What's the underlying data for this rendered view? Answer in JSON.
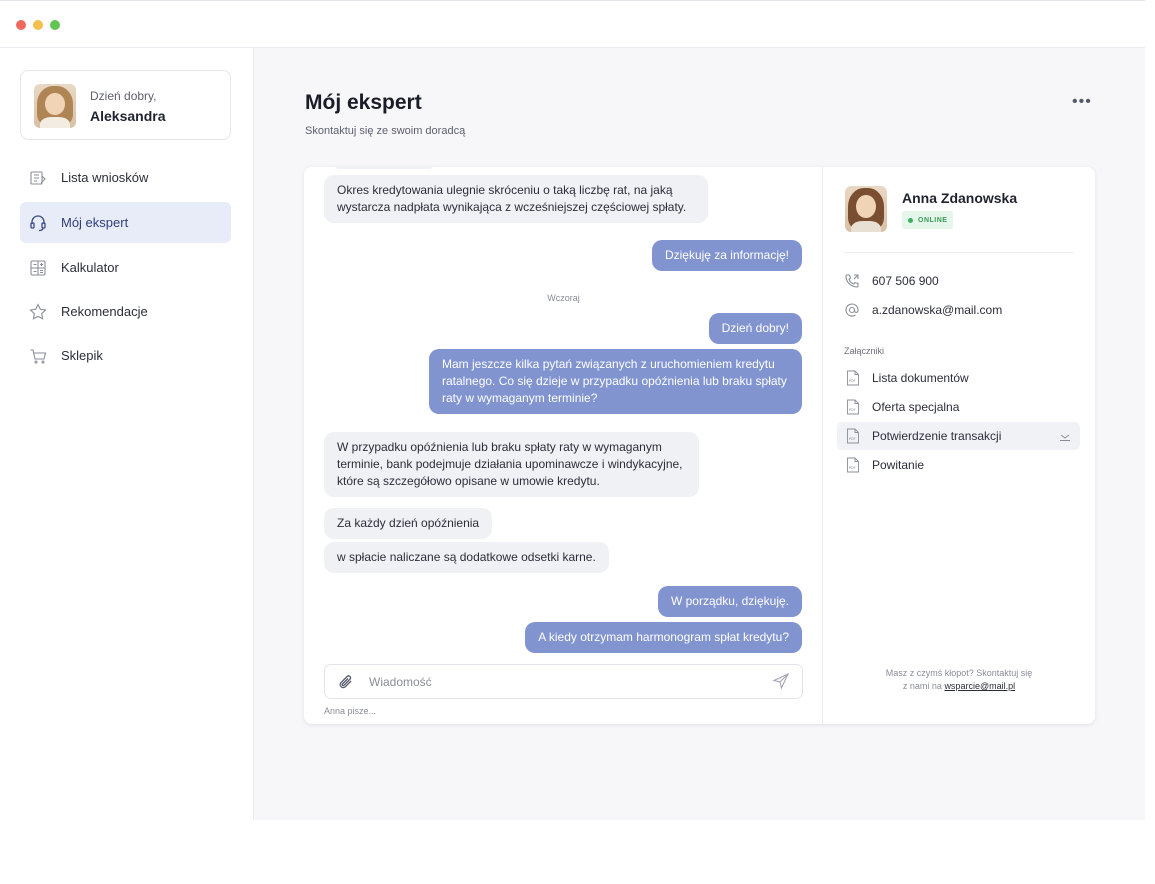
{
  "sidebar": {
    "greeting": "Dzień dobry,",
    "user_name": "Aleksandra",
    "items": [
      {
        "label": "Lista wniosków",
        "icon": "documents-icon"
      },
      {
        "label": "Mój ekspert",
        "icon": "headset-icon",
        "active": true
      },
      {
        "label": "Kalkulator",
        "icon": "calculator-icon"
      },
      {
        "label": "Rekomendacje",
        "icon": "star-icon"
      },
      {
        "label": "Sklepik",
        "icon": "cart-icon"
      }
    ]
  },
  "header": {
    "title": "Mój ekspert",
    "subtitle": "Skontaktuj się ze swoim doradcą",
    "more_label": "•••"
  },
  "chat": {
    "messages": [
      {
        "from": "expert",
        "text": "Okres kredytowania ulegnie skróceniu o taką liczbę rat, na jaką wystarcza nadpłata wynikająca z wcześniejszej częściowej spłaty."
      },
      {
        "from": "user",
        "text": "Dziękuję za informację!"
      },
      {
        "from": "user",
        "text": "Dzień dobry!"
      },
      {
        "from": "user",
        "text": "Mam jeszcze kilka pytań związanych z uruchomieniem kredytu ratalnego. Co się dzieje w przypadku opóźnienia lub braku spłaty raty w wymaganym terminie?"
      },
      {
        "from": "expert",
        "text": "W przypadku opóźnienia lub braku spłaty raty w wymaganym terminie, bank podejmuje działania upominawcze i windykacyjne, które są szczegółowo opisane w umowie kredytu."
      },
      {
        "from": "expert",
        "text": "Za każdy dzień opóźnienia"
      },
      {
        "from": "expert",
        "text": "w spłacie naliczane są dodatkowe odsetki karne."
      },
      {
        "from": "user",
        "text": "W porządku, dziękuję."
      },
      {
        "from": "user",
        "text": "A kiedy otrzymam harmonogram spłat kredytu?"
      }
    ],
    "day_separator": "Wczoraj",
    "input_placeholder": "Wiadomość",
    "input_value": "",
    "typing_status": "Anna pisze..."
  },
  "expert": {
    "name": "Anna Zdanowska",
    "status": "ONLINE",
    "phone": "607 506 900",
    "email": "a.zdanowska@mail.com",
    "attachments_title": "Załączniki",
    "attachments": [
      "Lista dokumentów",
      "Oferta specjalna",
      "Potwierdzenie transakcji",
      "Powitanie"
    ],
    "help_text": "Masz z czymś kłopot? Skontaktuj się",
    "help_text_2": "z nami na",
    "help_email": "wsparcie@mail.pl"
  },
  "colors": {
    "accent": "#8194d0",
    "active_nav_bg": "#e8ecf8",
    "online_green": "#3db15f"
  }
}
